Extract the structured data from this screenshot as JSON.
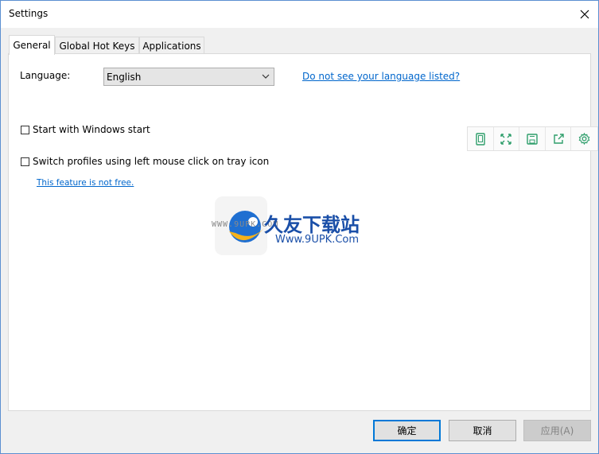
{
  "window": {
    "title": "Settings"
  },
  "tabs": [
    {
      "label": "General"
    },
    {
      "label": "Global Hot Keys"
    },
    {
      "label": "Applications"
    }
  ],
  "general": {
    "language_label": "Language:",
    "language_value": "English",
    "language_link": "Do not see your language listed?",
    "start_with_windows": {
      "label": "Start with Windows start",
      "checked": false
    },
    "switch_profiles": {
      "label": "Switch profiles using left mouse click on tray icon",
      "checked": false
    },
    "feature_note": "This feature is not free."
  },
  "watermark": {
    "brand_text": "久友下载站",
    "url_text": "Www.9UPK.Com",
    "small_text": "WWW.9UPK.COM"
  },
  "buttons": {
    "ok": "确定",
    "cancel": "取消",
    "apply": "应用(A)"
  },
  "colors": {
    "link": "#0066cc",
    "accent": "#0078d7",
    "toolbar_icon": "#2e9e6b"
  }
}
